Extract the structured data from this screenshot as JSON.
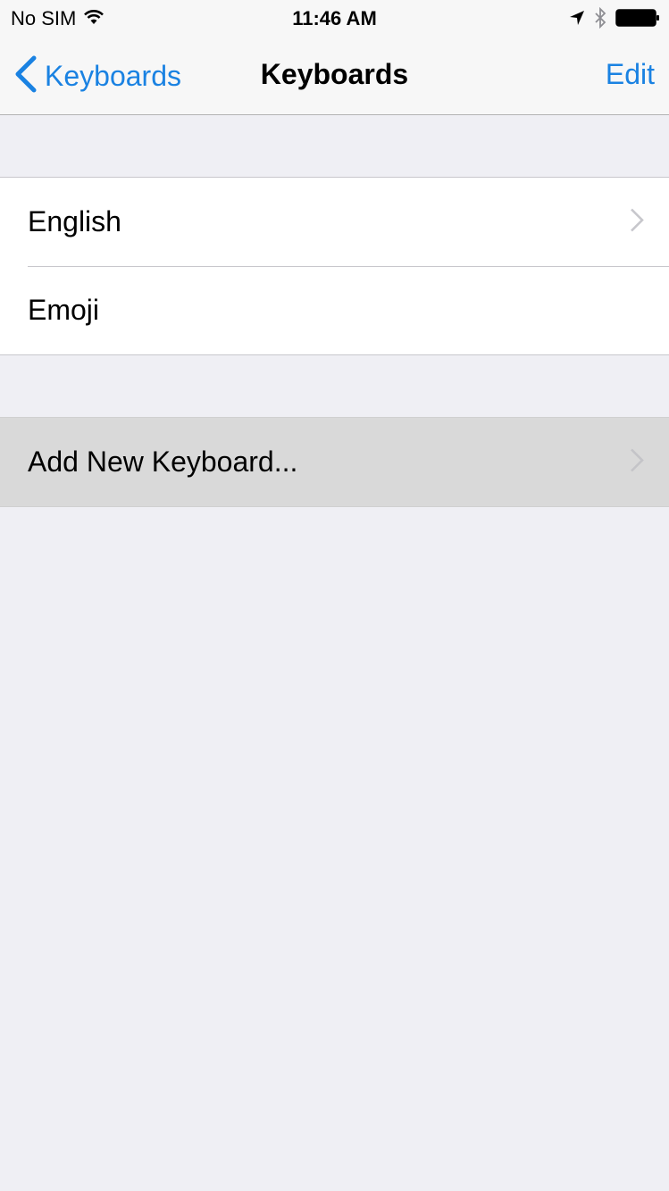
{
  "status_bar": {
    "carrier": "No SIM",
    "time": "11:46 AM",
    "icons": [
      "wifi-icon",
      "location-arrow-icon",
      "bluetooth-icon",
      "battery-icon"
    ]
  },
  "nav": {
    "back_label": "Keyboards",
    "title": "Keyboards",
    "edit_label": "Edit",
    "accent_color": "#1a82e2"
  },
  "keyboards": [
    {
      "label": "English",
      "has_chevron": true
    },
    {
      "label": "Emoji",
      "has_chevron": false
    }
  ],
  "add_keyboard": {
    "label": "Add New Keyboard...",
    "highlighted": true
  }
}
